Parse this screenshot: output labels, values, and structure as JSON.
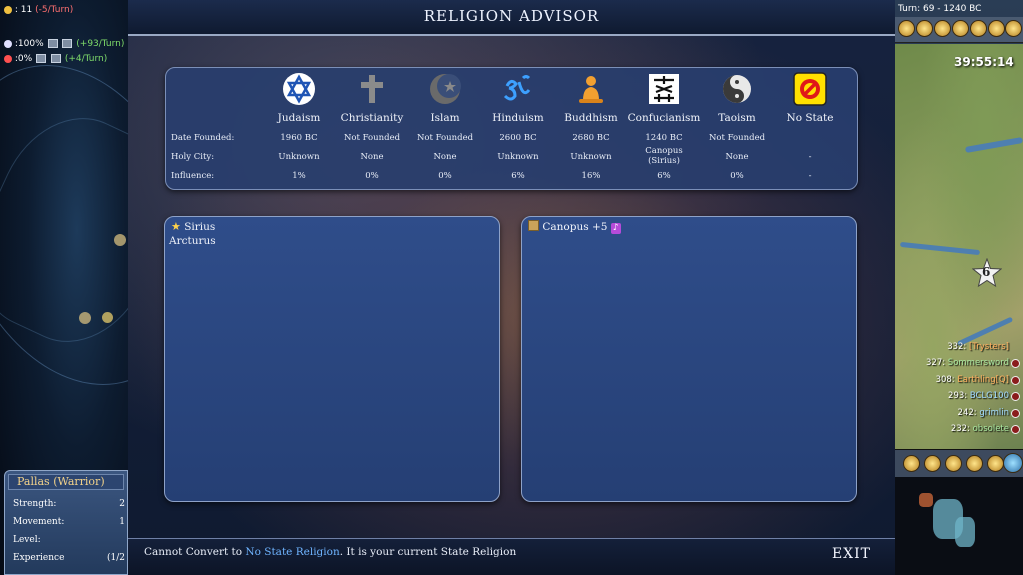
{
  "left_panel": {
    "row1": {
      "value": ": 11",
      "rate": "(-5/Turn)"
    },
    "row2": {
      "value": ":100%",
      "rate": "(+93/Turn)"
    },
    "row3": {
      "value": ":0%",
      "rate": "(+4/Turn)"
    },
    "unit": {
      "title": "Pallas (Warrior)",
      "stats": [
        {
          "label": "Strength:",
          "value": "2"
        },
        {
          "label": "Movement:",
          "value": "1"
        },
        {
          "label": "Level:",
          "value": ""
        },
        {
          "label": "Experience",
          "value": "(1/2"
        }
      ]
    }
  },
  "advisor": {
    "title": "RELIGION ADVISOR",
    "row_labels": {
      "founded": "Date Founded:",
      "holy_city": "Holy City:",
      "influence": "Influence:"
    },
    "religions": [
      {
        "name": "Judaism",
        "icon": "star-of-david-icon",
        "founded": "1960 BC",
        "holy_city": "Unknown",
        "influence": "1%"
      },
      {
        "name": "Christianity",
        "icon": "cross-icon",
        "founded": "Not Founded",
        "holy_city": "None",
        "influence": "0%"
      },
      {
        "name": "Islam",
        "icon": "crescent-icon",
        "founded": "Not Founded",
        "holy_city": "None",
        "influence": "0%"
      },
      {
        "name": "Hinduism",
        "icon": "om-icon",
        "founded": "2600 BC",
        "holy_city": "Unknown",
        "influence": "6%"
      },
      {
        "name": "Buddhism",
        "icon": "buddha-icon",
        "founded": "2680 BC",
        "holy_city": "Unknown",
        "influence": "16%"
      },
      {
        "name": "Confucianism",
        "icon": "confucian-glyph-icon",
        "founded": "1240 BC",
        "holy_city": "Canopus (Sirius)",
        "influence": "6%"
      },
      {
        "name": "Taoism",
        "icon": "yin-yang-icon",
        "founded": "Not Founded",
        "holy_city": "None",
        "influence": "0%"
      },
      {
        "name": "No State",
        "icon": "no-state-icon",
        "founded": "",
        "holy_city": "-",
        "influence": "-"
      }
    ],
    "left_panel": {
      "header": "Sirius",
      "items": [
        "Arcturus"
      ]
    },
    "right_panel": {
      "header": "Canopus",
      "bonus": "+5"
    },
    "status": {
      "prefix": "Cannot Convert to ",
      "highlight": "No State Religion",
      "suffix": ". It is your current State Religion"
    },
    "exit_label": "EXIT"
  },
  "right_panel": {
    "turn": "Turn: 69 - 1240 BC",
    "clock": "39:55:14",
    "badge": "6",
    "scores": [
      {
        "score": "332:",
        "name": "[Trysters]"
      },
      {
        "score": "327:",
        "name": "Sommersword"
      },
      {
        "score": "308:",
        "name": "Earthling[Q]"
      },
      {
        "score": "293:",
        "name": "BCLG100"
      },
      {
        "score": "242:",
        "name": "grimlin"
      },
      {
        "score": "232:",
        "name": "obsolete"
      }
    ]
  },
  "colors": {
    "highlight": "#6fb4ff",
    "negative": "#ff7070",
    "positive": "#7fdc6a"
  }
}
